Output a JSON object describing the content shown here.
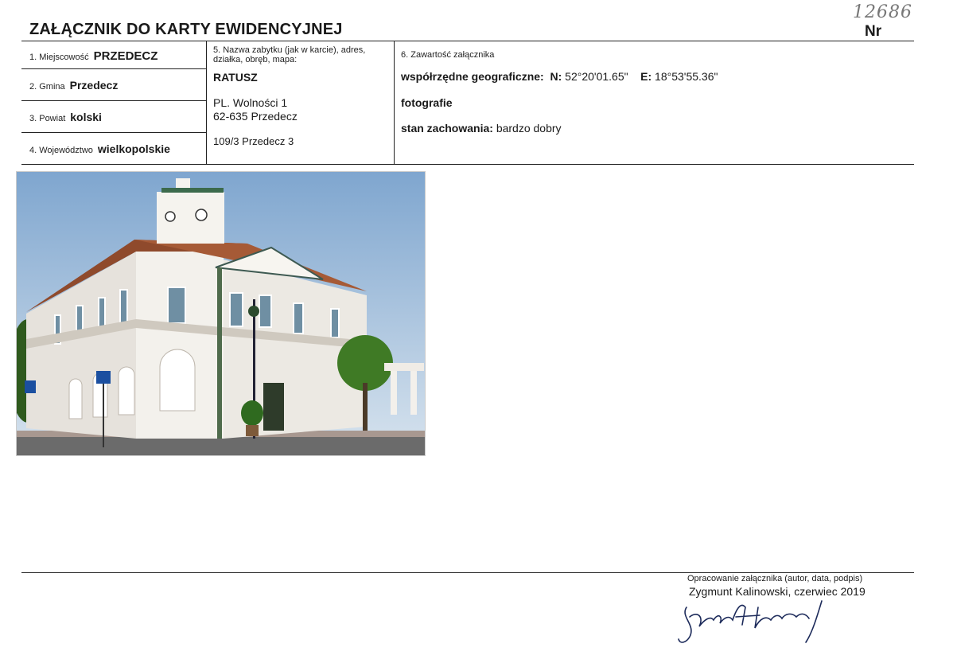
{
  "header": {
    "title": "ZAŁĄCZNIK DO KARTY EWIDENCYJNEJ",
    "nr_label": "Nr",
    "handwritten_number": "12686"
  },
  "fields": {
    "miejscowosc": {
      "label": "1. Miejscowość",
      "value": "PRZEDECZ"
    },
    "gmina": {
      "label": "2. Gmina",
      "value": "Przedecz"
    },
    "powiat": {
      "label": "3. Powiat",
      "value": "kolski"
    },
    "wojewodztwo": {
      "label": "4. Województwo",
      "value": "wielkopolskie"
    }
  },
  "section5": {
    "label_line1": "5. Nazwa zabytku (jak w karcie), adres,",
    "label_line2": "działka, obręb, mapa:",
    "name": "RATUSZ",
    "address_line1": "PL. Wolności 1",
    "address_line2": "62-635 Przedecz",
    "parcel": "109/3 Przedecz 3"
  },
  "section6": {
    "label": "6. Zawartość załącznika",
    "coords_label": "współrzędne geograficzne:",
    "n_label": "N:",
    "n_value": "52°20'01.65\"",
    "e_label": "E:",
    "e_value": "18°53'55.36\"",
    "photos": "fotografie",
    "condition_label": "stan zachowania:",
    "condition_value": "bardzo dobry"
  },
  "footer": {
    "prepared_label": "Opracowanie załącznika (autor, data, podpis)",
    "author_date": "Zygmunt Kalinowski, czerwiec 2019"
  }
}
